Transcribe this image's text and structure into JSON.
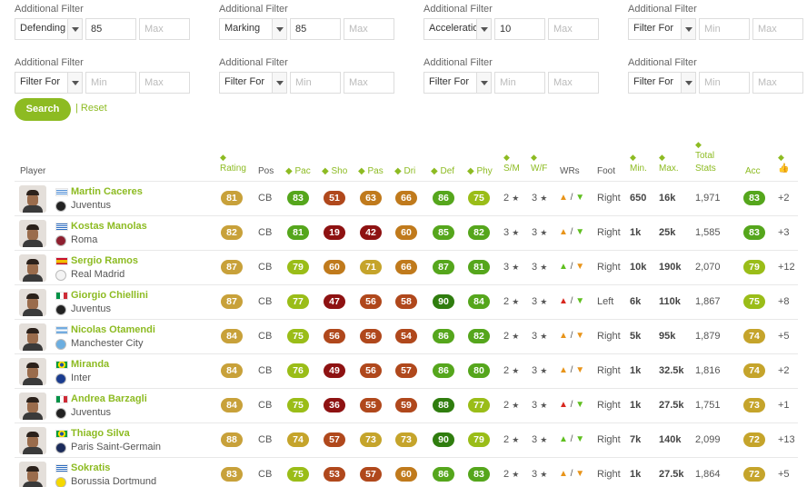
{
  "filters": [
    {
      "label": "Additional Filter",
      "select": "Defending",
      "min": "85",
      "max": "Max"
    },
    {
      "label": "Additional Filter",
      "select": "Marking",
      "min": "85",
      "max": "Max"
    },
    {
      "label": "Additional Filter",
      "select": "Acceleration",
      "min": "10",
      "max": "Max"
    },
    {
      "label": "Additional Filter",
      "select": "Filter For",
      "min": "Min",
      "max": "Max"
    },
    {
      "label": "Additional Filter",
      "select": "Filter For",
      "min": "Min",
      "max": "Max"
    },
    {
      "label": "Additional Filter",
      "select": "Filter For",
      "min": "Min",
      "max": "Max"
    },
    {
      "label": "Additional Filter",
      "select": "Filter For",
      "min": "Min",
      "max": "Max"
    },
    {
      "label": "Additional Filter",
      "select": "Filter For",
      "min": "Min",
      "max": "Max"
    }
  ],
  "search_label": "Search",
  "reset_label": "| Reset",
  "columns": {
    "player": "Player",
    "rating": "Rating",
    "pos": "Pos",
    "pac": "Pac",
    "sho": "Sho",
    "pas": "Pas",
    "dri": "Dri",
    "def": "Def",
    "phy": "Phy",
    "sm": "S/M",
    "wf": "W/F",
    "wrs": "WRs",
    "foot": "Foot",
    "min": "Min.",
    "max": "Max.",
    "total1": "Total",
    "total2": "Stats",
    "acc": "Acc"
  },
  "sort_glyph": "◆",
  "colors": {
    "accent": "#8dbb22",
    "rating": "#c8a13a",
    "excellent": "#2f7d0e",
    "green": "#55a61c",
    "lime": "#9abd18",
    "olive": "#c5a42b",
    "orange": "#c07a1c",
    "brown": "#b0481c",
    "red": "#8e1212"
  },
  "players": [
    {
      "name": "Martin Caceres",
      "club": "Juventus",
      "flag": "uruguay",
      "crest": "juventus",
      "rating": "81",
      "pos": "CB",
      "pac": "83",
      "sho": "51",
      "pas": "63",
      "dri": "66",
      "def": "86",
      "phy": "75",
      "sm": "2",
      "wf": "3",
      "wr_att": "orange",
      "wr_def": "green",
      "foot": "Right",
      "min": "650",
      "max": "16k",
      "total": "1,971",
      "acc": "83",
      "likes": "+2"
    },
    {
      "name": "Kostas Manolas",
      "club": "Roma",
      "flag": "greece",
      "crest": "roma",
      "rating": "82",
      "pos": "CB",
      "pac": "81",
      "sho": "19",
      "pas": "42",
      "dri": "60",
      "def": "85",
      "phy": "82",
      "sm": "3",
      "wf": "3",
      "wr_att": "orange",
      "wr_def": "green",
      "foot": "Right",
      "min": "1k",
      "max": "25k",
      "total": "1,585",
      "acc": "83",
      "likes": "+3"
    },
    {
      "name": "Sergio Ramos",
      "club": "Real Madrid",
      "flag": "spain",
      "crest": "realmadrid",
      "rating": "87",
      "pos": "CB",
      "pac": "79",
      "sho": "60",
      "pas": "71",
      "dri": "66",
      "def": "87",
      "phy": "81",
      "sm": "3",
      "wf": "3",
      "wr_att": "green",
      "wr_def": "orange",
      "foot": "Right",
      "min": "10k",
      "max": "190k",
      "total": "2,070",
      "acc": "79",
      "likes": "+12"
    },
    {
      "name": "Giorgio Chiellini",
      "club": "Juventus",
      "flag": "italy",
      "crest": "juventus",
      "rating": "87",
      "pos": "CB",
      "pac": "77",
      "sho": "47",
      "pas": "56",
      "dri": "58",
      "def": "90",
      "phy": "84",
      "sm": "2",
      "wf": "3",
      "wr_att": "red",
      "wr_def": "green",
      "foot": "Left",
      "min": "6k",
      "max": "110k",
      "total": "1,867",
      "acc": "75",
      "likes": "+8"
    },
    {
      "name": "Nicolas Otamendi",
      "club": "Manchester City",
      "flag": "argentina",
      "crest": "mancity",
      "rating": "84",
      "pos": "CB",
      "pac": "75",
      "sho": "56",
      "pas": "56",
      "dri": "54",
      "def": "86",
      "phy": "82",
      "sm": "2",
      "wf": "3",
      "wr_att": "orange",
      "wr_def": "orange",
      "foot": "Right",
      "min": "5k",
      "max": "95k",
      "total": "1,879",
      "acc": "74",
      "likes": "+5"
    },
    {
      "name": "Miranda",
      "club": "Inter",
      "flag": "brazil",
      "crest": "inter",
      "rating": "84",
      "pos": "CB",
      "pac": "76",
      "sho": "49",
      "pas": "56",
      "dri": "57",
      "def": "86",
      "phy": "80",
      "sm": "2",
      "wf": "3",
      "wr_att": "orange",
      "wr_def": "orange",
      "foot": "Right",
      "min": "1k",
      "max": "32.5k",
      "total": "1,816",
      "acc": "74",
      "likes": "+2"
    },
    {
      "name": "Andrea Barzagli",
      "club": "Juventus",
      "flag": "italy",
      "crest": "juventus",
      "rating": "84",
      "pos": "CB",
      "pac": "75",
      "sho": "36",
      "pas": "55",
      "dri": "59",
      "def": "88",
      "phy": "77",
      "sm": "2",
      "wf": "3",
      "wr_att": "red",
      "wr_def": "green",
      "foot": "Right",
      "min": "1k",
      "max": "27.5k",
      "total": "1,751",
      "acc": "73",
      "likes": "+1"
    },
    {
      "name": "Thiago Silva",
      "club": "Paris Saint-Germain",
      "flag": "brazil",
      "crest": "psg",
      "rating": "88",
      "pos": "CB",
      "pac": "74",
      "sho": "57",
      "pas": "73",
      "dri": "73",
      "def": "90",
      "phy": "79",
      "sm": "2",
      "wf": "3",
      "wr_att": "green",
      "wr_def": "green",
      "foot": "Right",
      "min": "7k",
      "max": "140k",
      "total": "2,099",
      "acc": "72",
      "likes": "+13"
    },
    {
      "name": "Sokratis",
      "club": "Borussia Dortmund",
      "flag": "greece",
      "crest": "dortmund",
      "rating": "83",
      "pos": "CB",
      "pac": "75",
      "sho": "53",
      "pas": "57",
      "dri": "60",
      "def": "86",
      "phy": "83",
      "sm": "2",
      "wf": "3",
      "wr_att": "orange",
      "wr_def": "orange",
      "foot": "Right",
      "min": "1k",
      "max": "27.5k",
      "total": "1,864",
      "acc": "72",
      "likes": "+5"
    }
  ]
}
